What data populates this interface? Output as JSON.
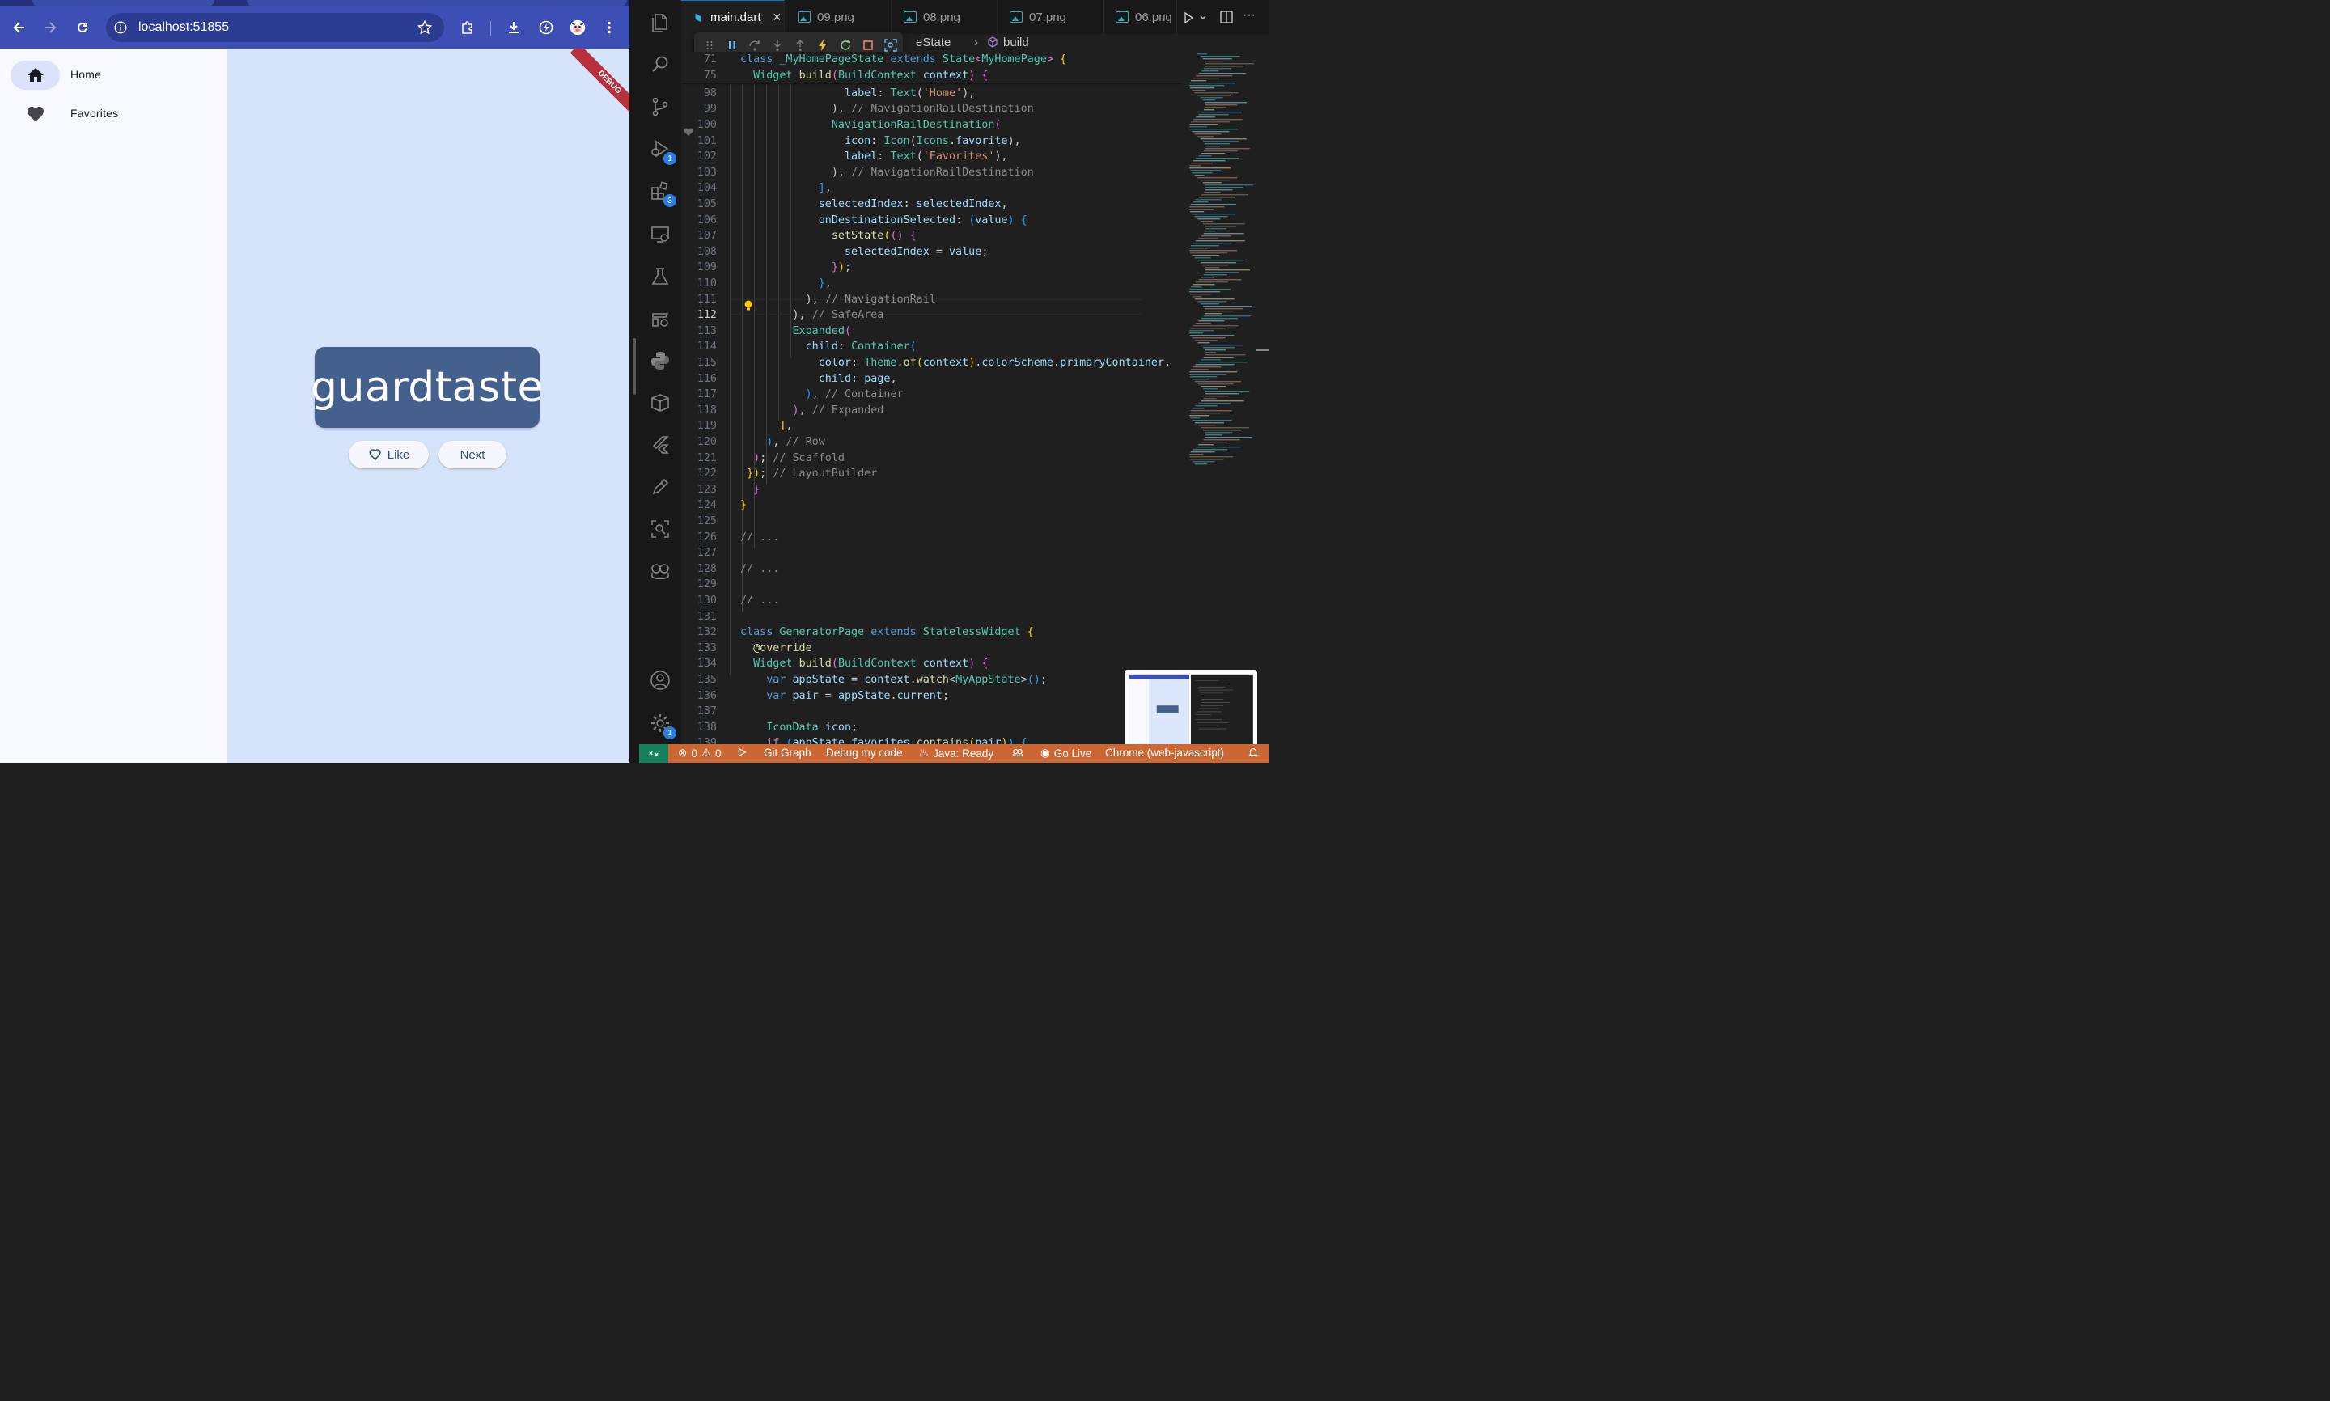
{
  "browser": {
    "url": "localhost:51855",
    "nav_items": [
      {
        "label": "Home",
        "icon": "home-icon",
        "active": true
      },
      {
        "label": "Favorites",
        "icon": "heart-icon",
        "active": false
      }
    ],
    "word": "guardtaste",
    "like_label": "Like",
    "next_label": "Next",
    "debug_banner": "DEBUG",
    "colors": {
      "toolbar": "#3d4fb4",
      "main_bg": "#d5e3fb",
      "card": "#43618c",
      "debug": "#b6313b"
    }
  },
  "vscode": {
    "tabs": [
      {
        "label": "main.dart",
        "active": true
      },
      {
        "label": "09.png",
        "active": false
      },
      {
        "label": "08.png",
        "active": false
      },
      {
        "label": "07.png",
        "active": false
      },
      {
        "label": "06.png",
        "active": false
      }
    ],
    "breadcrumb": {
      "class": "eState",
      "member": "build"
    },
    "activity_badges": {
      "run": "1",
      "extensions": "3",
      "settings": "1"
    },
    "current_line": "112",
    "status": {
      "errors": "0",
      "warnings": "0",
      "git": "Git Graph",
      "debug": "Debug my code",
      "java": "Java: Ready",
      "golive": "Go Live",
      "device": "Chrome (web-javascript)"
    },
    "colors": {
      "statusbar": "#cc6633",
      "remote": "#16825d"
    }
  }
}
